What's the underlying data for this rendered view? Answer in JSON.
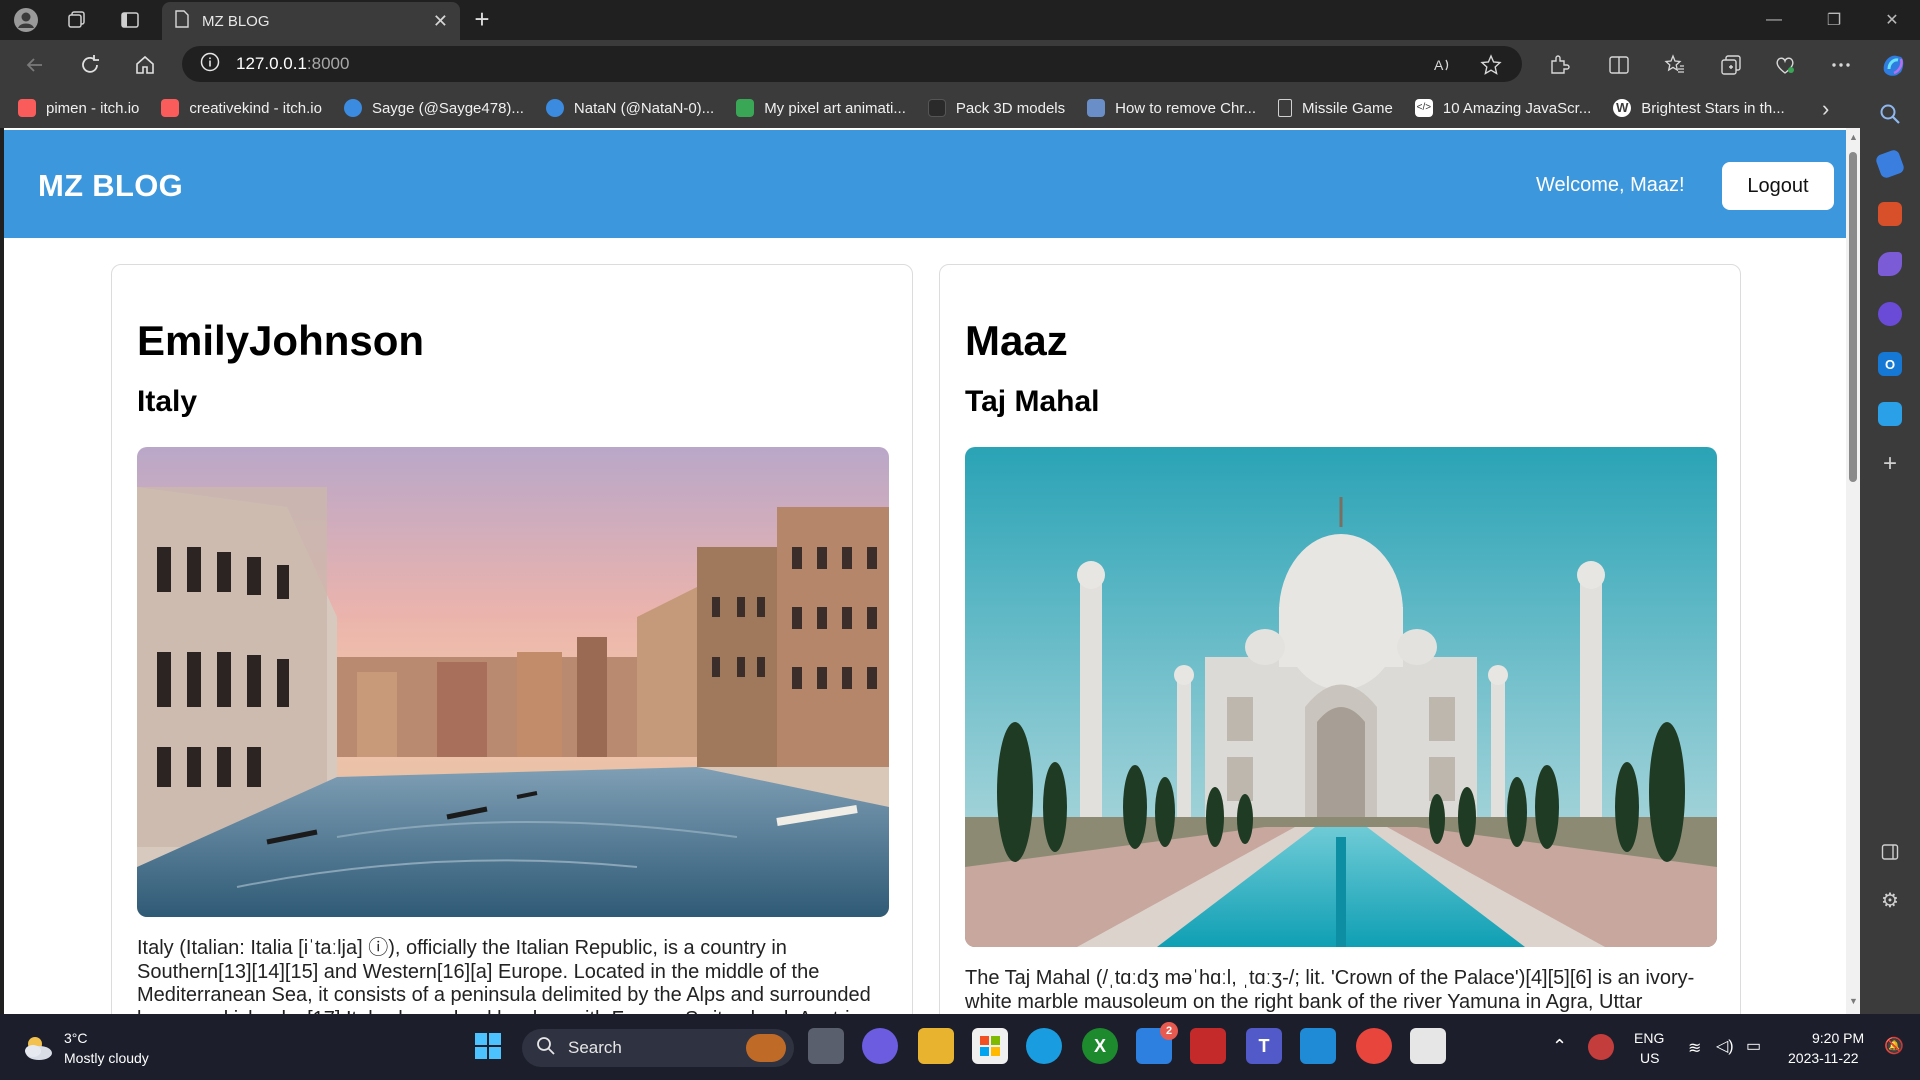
{
  "browser": {
    "tab_title": "MZ BLOG",
    "url_host": "127.0.0.1",
    "url_port": ":8000",
    "bookmarks": [
      {
        "label": "pimen - itch.io",
        "color": "#fa5c5c"
      },
      {
        "label": "creativekind - itch.io",
        "color": "#fa5c5c"
      },
      {
        "label": "Sayge (@Sayge478)...",
        "color": "#3b8be0"
      },
      {
        "label": "NataN (@NataN-0)...",
        "color": "#3b8be0"
      },
      {
        "label": "My pixel art animati...",
        "color": "#3aa757"
      },
      {
        "label": "Pack 3D models",
        "color": "#2a2a2a"
      },
      {
        "label": "How to remove Chr...",
        "color": "#6a8ec8"
      },
      {
        "label": "Missile Game",
        "color": "#d0d0d0"
      },
      {
        "label": "10 Amazing JavaScr...",
        "color": "#ffffff"
      },
      {
        "label": "Brightest Stars in th...",
        "color": "#ffffff"
      }
    ]
  },
  "site": {
    "title": "MZ BLOG",
    "welcome": "Welcome, Maaz!",
    "logout_label": "Logout",
    "header_color": "#3d97dc"
  },
  "posts": [
    {
      "author": "EmilyJohnson",
      "title": "Italy",
      "image_desc": "venice-canal-photo",
      "text": "Italy (Italian: Italia [iˈtaːlja] ⓘ), officially the Italian Republic, is a country in Southern[13][14][15] and Western[16][a] Europe. Located in the middle of the Mediterranean Sea, it consists of a peninsula delimited by the Alps and surrounded by several islands; [17] Italy shares land borders with France, Switzerland, Austria,"
    },
    {
      "author": "Maaz",
      "title": "Taj Mahal",
      "image_desc": "taj-mahal-photo",
      "text": "The Taj Mahal (/ˌtɑːdʒ məˈhɑːl, ˌtɑːʒ-/; lit. 'Crown of the Palace')[4][5][6] is an ivory-white marble mausoleum on the right bank of the river Yamuna in Agra, Uttar"
    }
  ],
  "taskbar": {
    "weather_temp": "3°C",
    "weather_desc": "Mostly cloudy",
    "search_label": "Search",
    "lang_line1": "ENG",
    "lang_line2": "US",
    "time": "9:20 PM",
    "date": "2023-11-22",
    "mail_badge": "2"
  }
}
